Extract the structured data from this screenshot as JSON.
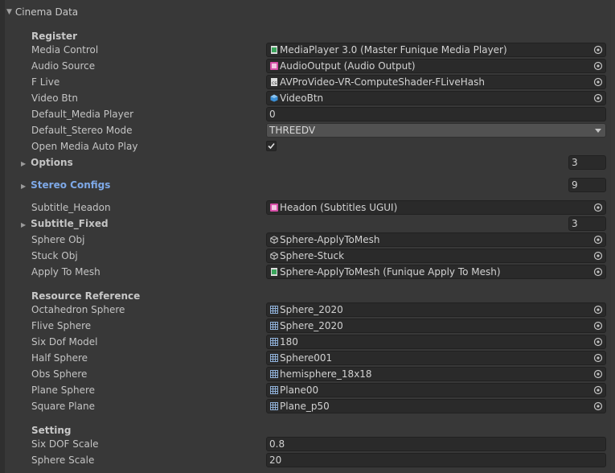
{
  "component": {
    "title": "Cinema Data"
  },
  "sections": {
    "register": "Register",
    "resource": "Resource Reference",
    "setting": "Setting"
  },
  "fields": {
    "media_control": {
      "label": "Media Control",
      "value": "MediaPlayer 3.0 (Master Funique Media Player)",
      "icon": "script-icon"
    },
    "audio_source": {
      "label": "Audio Source",
      "value": "AudioOutput (Audio Output)",
      "icon": "audio-script-icon"
    },
    "f_live": {
      "label": "F Live",
      "value": "AVProVideo-VR-ComputeShader-FLiveHash",
      "icon": "compute-shader-icon"
    },
    "video_btn": {
      "label": "Video Btn",
      "value": "VideoBtn",
      "icon": "gameobject-icon"
    },
    "default_media_player": {
      "label": "Default_Media Player",
      "value": "0"
    },
    "default_stereo_mode": {
      "label": "Default_Stereo Mode",
      "value": "THREEDV"
    },
    "open_media_auto_play": {
      "label": "Open Media Auto Play",
      "checked": true
    },
    "options": {
      "label": "Options",
      "value": "3"
    },
    "stereo_configs": {
      "label": "Stereo Configs",
      "value": "9"
    },
    "subtitle_headon": {
      "label": "Subtitle_Headon",
      "value": "Headon (Subtitles UGUI)",
      "icon": "subtitle-script-icon"
    },
    "subtitle_fixed": {
      "label": "Subtitle_Fixed",
      "value": "3"
    },
    "sphere_obj": {
      "label": "Sphere Obj",
      "value": "Sphere-ApplyToMesh",
      "icon": "gameobject-icon"
    },
    "stuck_obj": {
      "label": "Stuck Obj",
      "value": "Sphere-Stuck",
      "icon": "gameobject-icon"
    },
    "apply_to_mesh": {
      "label": "Apply To Mesh",
      "value": "Sphere-ApplyToMesh (Funique Apply To Mesh)",
      "icon": "script-icon"
    },
    "octahedron_sphere": {
      "label": "Octahedron Sphere",
      "value": "Sphere_2020",
      "icon": "mesh-icon"
    },
    "flive_sphere": {
      "label": "Flive Sphere",
      "value": "Sphere_2020",
      "icon": "mesh-icon"
    },
    "six_dof_model": {
      "label": "Six Dof Model",
      "value": "180",
      "icon": "mesh-icon"
    },
    "half_sphere": {
      "label": "Half Sphere",
      "value": "Sphere001",
      "icon": "mesh-icon"
    },
    "obs_sphere": {
      "label": "Obs Sphere",
      "value": "hemisphere_18x18",
      "icon": "mesh-icon"
    },
    "plane_sphere": {
      "label": "Plane Sphere",
      "value": "Plane00",
      "icon": "mesh-icon"
    },
    "square_plane": {
      "label": "Square Plane",
      "value": "Plane_p50",
      "icon": "mesh-icon"
    },
    "six_dof_scale": {
      "label": "Six DOF Scale",
      "value": "0.8"
    },
    "sphere_scale": {
      "label": "Sphere Scale",
      "value": "20"
    }
  },
  "colors": {
    "background": "#383838",
    "field": "#2a2a2a",
    "highlight_label": "#7ea9e8"
  }
}
